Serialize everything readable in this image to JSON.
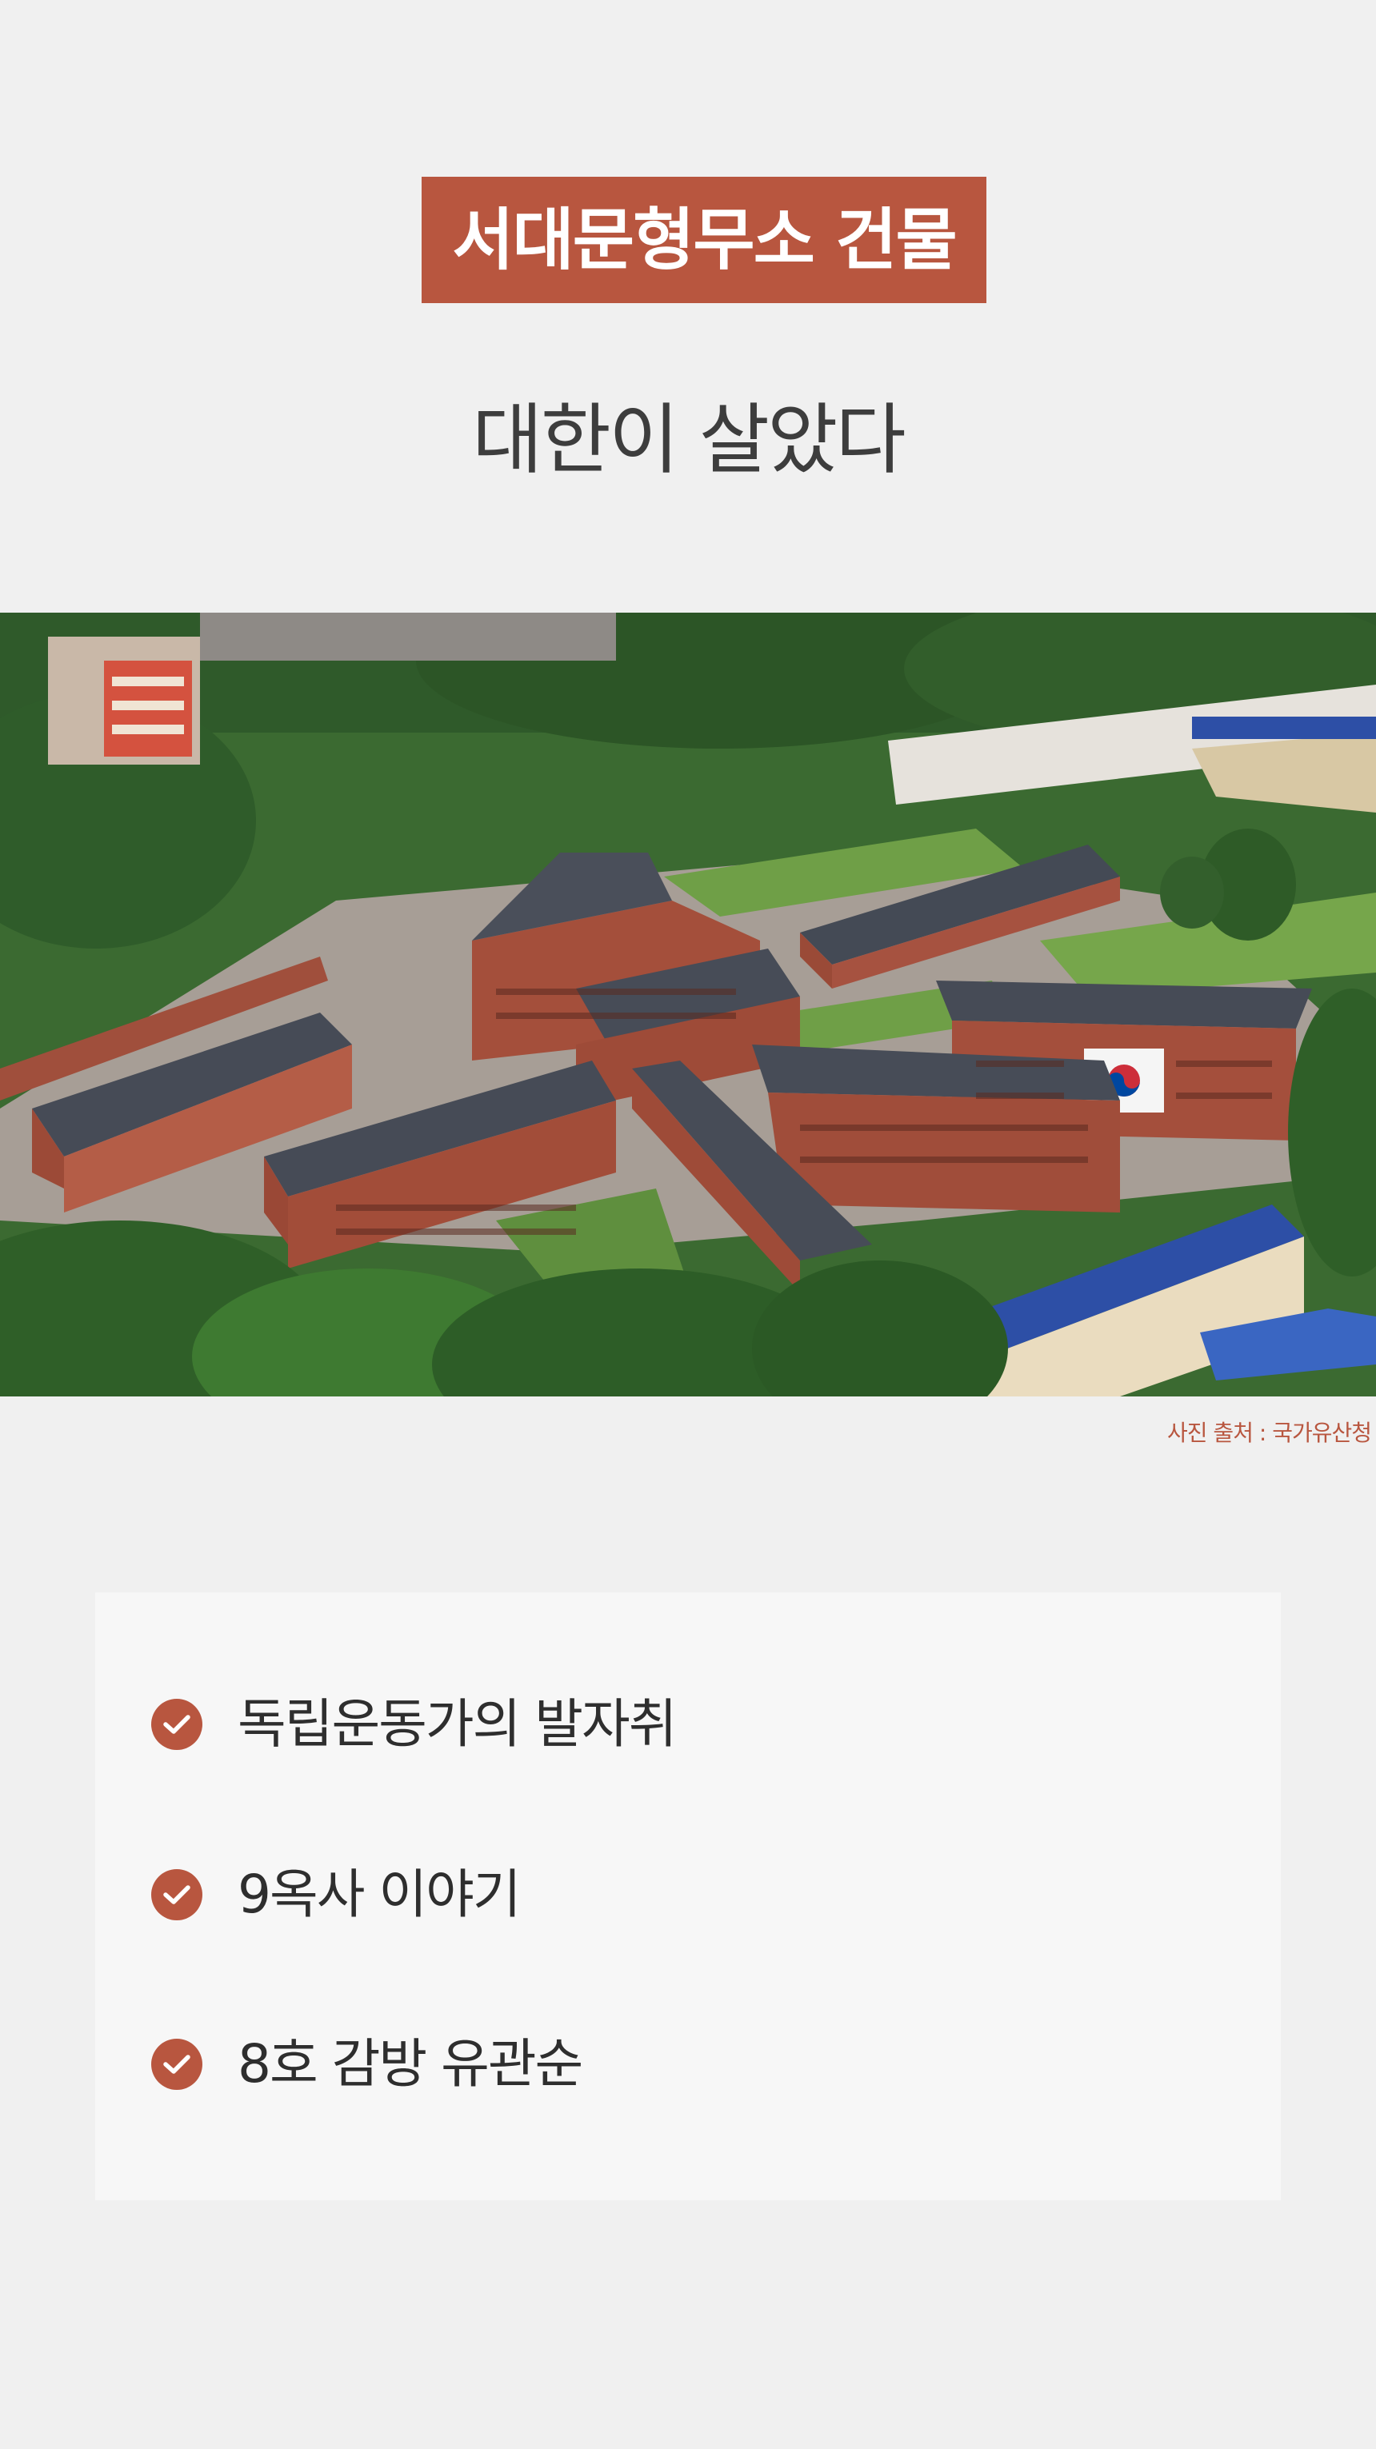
{
  "header": {
    "title": "서대문형무소 건물",
    "subtitle": "대한이 살았다"
  },
  "photo": {
    "credit": "사진 출처 : 국가유산청"
  },
  "checklist": {
    "items": [
      {
        "label": "독립운동가의 발자취",
        "icon": "check-circle-icon"
      },
      {
        "label": "9옥사 이야기",
        "icon": "check-circle-icon"
      },
      {
        "label": "8호 감방 유관순",
        "icon": "check-circle-icon"
      }
    ]
  },
  "colors": {
    "accent": "#b8563f",
    "background": "#f0f0f0",
    "card": "#f7f7f7",
    "text": "#3d3d3d"
  }
}
